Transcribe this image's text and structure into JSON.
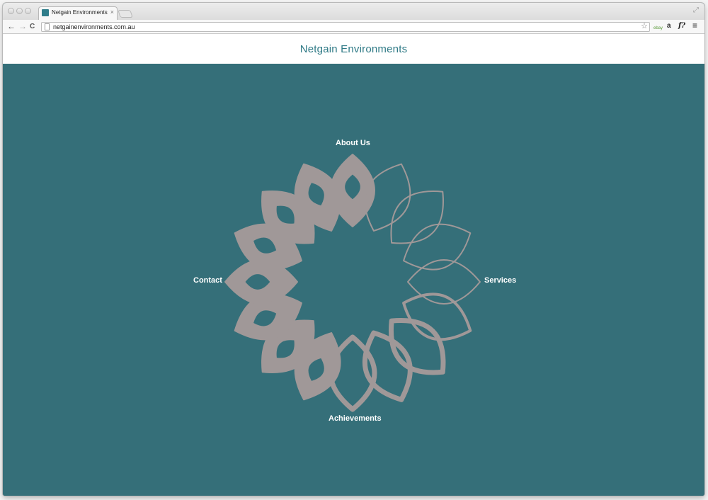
{
  "browser": {
    "tab": {
      "title": "Netgain Environments",
      "close_glyph": "×"
    },
    "url": "netgainenvironments.com.au",
    "nav": {
      "back_glyph": "←",
      "forward_glyph": "→",
      "reload_glyph": "C"
    },
    "extensions": {
      "amazon_glyph": "a",
      "fx_glyph": "f?",
      "menu_glyph": "≡"
    },
    "star_glyph": "☆"
  },
  "site": {
    "title": "Netgain Environments",
    "background_color": "#356f79",
    "petal_color": "#a09898"
  },
  "menu": {
    "about": "About Us",
    "services": "Services",
    "achievements": "Achievements",
    "contact": "Contact"
  }
}
